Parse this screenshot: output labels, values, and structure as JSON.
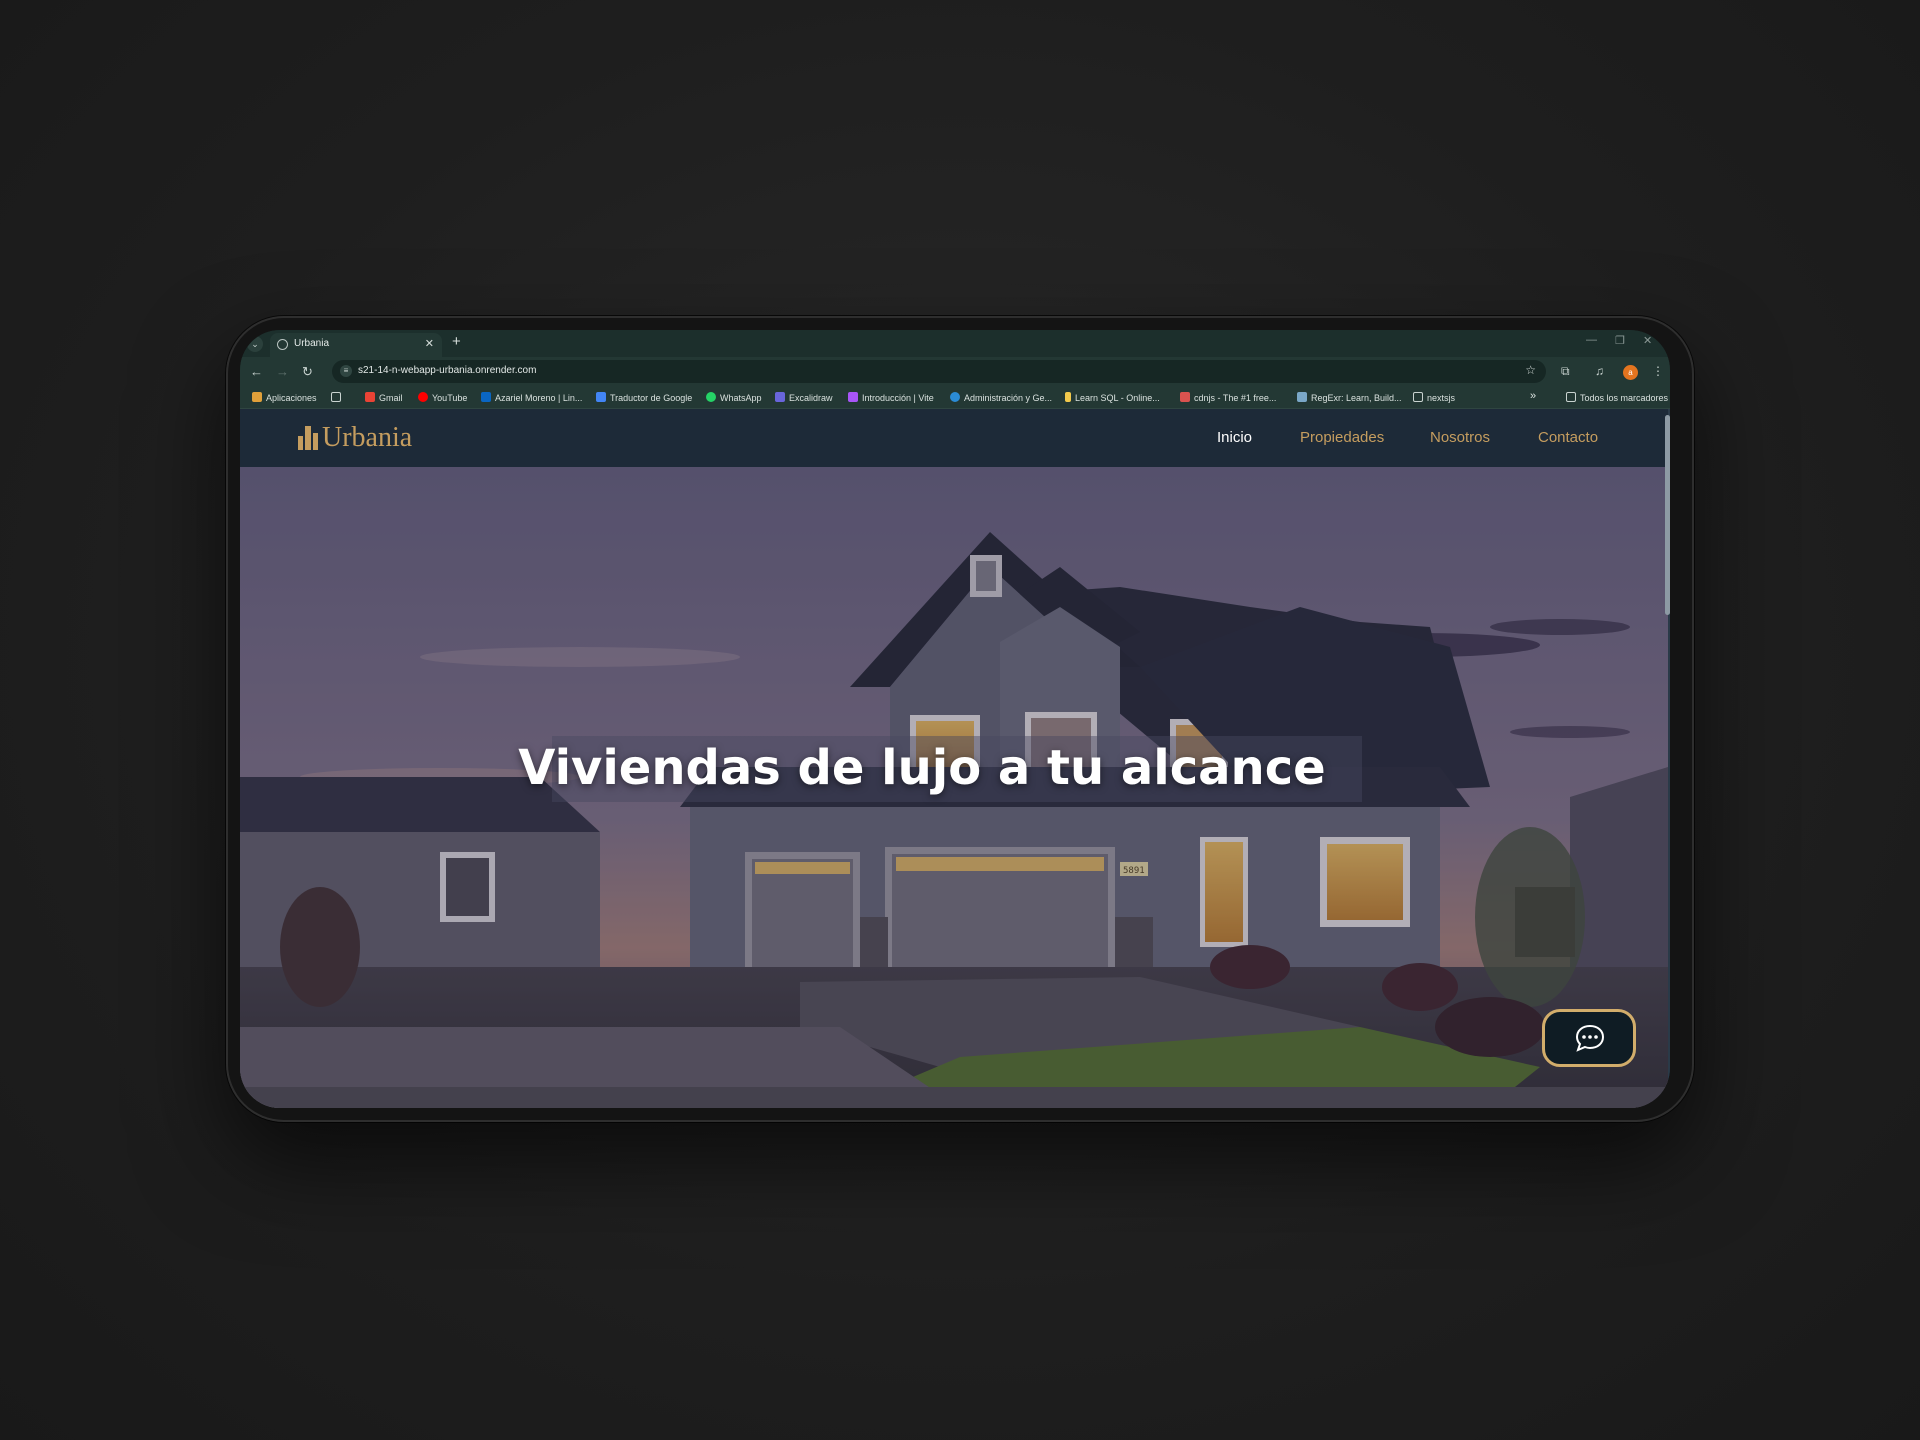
{
  "browser": {
    "tab_title": "Urbania",
    "new_tab_label": "+",
    "url": "s21-14-n-webapp-urbania.onrender.com",
    "profile_initial": "a",
    "bookmarks": [
      {
        "label": "Aplicaciones",
        "icon": "apps-grid-icon",
        "color": "#e0a03a"
      },
      {
        "label": "",
        "icon": "grid-icon",
        "color": "#c9d3d0"
      },
      {
        "label": "Gmail",
        "icon": "gmail-icon",
        "color": "#ea4335"
      },
      {
        "label": "YouTube",
        "icon": "youtube-icon",
        "color": "#ff0000"
      },
      {
        "label": "Azariel Moreno | Lin...",
        "icon": "linkedin-icon",
        "color": "#0a66c2"
      },
      {
        "label": "Traductor de Google",
        "icon": "translate-icon",
        "color": "#4285f4"
      },
      {
        "label": "WhatsApp",
        "icon": "whatsapp-icon",
        "color": "#25d366"
      },
      {
        "label": "Excalidraw",
        "icon": "excalidraw-icon",
        "color": "#6965db"
      },
      {
        "label": "Introducción | Vite",
        "icon": "vite-icon",
        "color": "#a855f7"
      },
      {
        "label": "Administración y Ge...",
        "icon": "edge-icon",
        "color": "#2b8cd6"
      },
      {
        "label": "Learn SQL - Online...",
        "icon": "sql-icon",
        "color": "#f2c94c"
      },
      {
        "label": "cdnjs - The #1 free...",
        "icon": "code-icon",
        "color": "#d9534f"
      },
      {
        "label": "RegExr: Learn, Build...",
        "icon": "regexr-icon",
        "color": "#7aa7c7"
      },
      {
        "label": "nextsjs",
        "icon": "folder-icon",
        "color": "#c9d3d0"
      }
    ],
    "overflow_label": "»",
    "all_bookmarks": "Todos los marcadores"
  },
  "site": {
    "logo_text": "Urbania",
    "nav": [
      {
        "label": "Inicio",
        "active": true
      },
      {
        "label": "Propiedades",
        "active": false
      },
      {
        "label": "Nosotros",
        "active": false
      },
      {
        "label": "Contacto",
        "active": false
      }
    ],
    "hero_title": "Viviendas de lujo a tu alcance",
    "house_number": "5891",
    "accent_color": "#c59d5f"
  }
}
